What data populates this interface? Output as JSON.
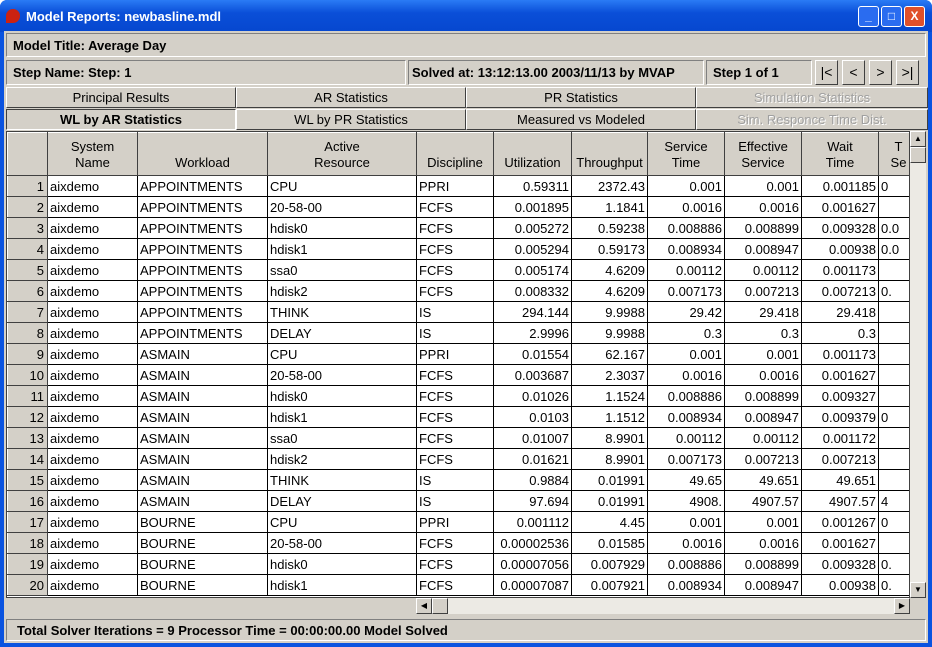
{
  "window": {
    "title": "Model Reports: newbasline.mdl",
    "min": "_",
    "max": "□",
    "close": "X"
  },
  "model_title": "Model Title: Average Day",
  "step_name": "Step Name:  Step: 1",
  "solved_at": "Solved at: 13:12:13.00  2003/11/13 by MVAP",
  "step_of": "Step 1 of 1",
  "nav": {
    "first": "|<",
    "prev": "<",
    "next": ">",
    "last": ">|"
  },
  "tabs_row1": [
    {
      "label": "Principal Results",
      "enabled": true
    },
    {
      "label": "AR Statistics",
      "enabled": true
    },
    {
      "label": "PR Statistics",
      "enabled": true
    },
    {
      "label": "Simulation Statistics",
      "enabled": false
    }
  ],
  "tabs_row2": [
    {
      "label": "WL by AR Statistics",
      "enabled": true,
      "active": true
    },
    {
      "label": "WL by PR Statistics",
      "enabled": true
    },
    {
      "label": "Measured vs Modeled",
      "enabled": true
    },
    {
      "label": "Sim. Responce Time Dist.",
      "enabled": false
    }
  ],
  "columns": [
    [
      "",
      ""
    ],
    [
      "System",
      "Name"
    ],
    [
      "",
      "Workload"
    ],
    [
      "Active",
      "Resource"
    ],
    [
      "",
      "Discipline"
    ],
    [
      "",
      "Utilization"
    ],
    [
      "",
      "Throughput"
    ],
    [
      "Service",
      "Time"
    ],
    [
      "Effective",
      "Service"
    ],
    [
      "Wait",
      "Time"
    ],
    [
      "T",
      "Se"
    ]
  ],
  "rows": [
    [
      "1",
      "aixdemo",
      "APPOINTMENTS",
      "CPU",
      "PPRI",
      "0.59311",
      "2372.43",
      "0.001",
      "0.001",
      "0.001185",
      "0"
    ],
    [
      "2",
      "aixdemo",
      "APPOINTMENTS",
      "20-58-00",
      "FCFS",
      "0.001895",
      "1.1841",
      "0.0016",
      "0.0016",
      "0.001627",
      ""
    ],
    [
      "3",
      "aixdemo",
      "APPOINTMENTS",
      "hdisk0",
      "FCFS",
      "0.005272",
      "0.59238",
      "0.008886",
      "0.008899",
      "0.009328",
      "0.0"
    ],
    [
      "4",
      "aixdemo",
      "APPOINTMENTS",
      "hdisk1",
      "FCFS",
      "0.005294",
      "0.59173",
      "0.008934",
      "0.008947",
      "0.00938",
      "0.0"
    ],
    [
      "5",
      "aixdemo",
      "APPOINTMENTS",
      "ssa0",
      "FCFS",
      "0.005174",
      "4.6209",
      "0.00112",
      "0.00112",
      "0.001173",
      ""
    ],
    [
      "6",
      "aixdemo",
      "APPOINTMENTS",
      "hdisk2",
      "FCFS",
      "0.008332",
      "4.6209",
      "0.007173",
      "0.007213",
      "0.007213",
      "0."
    ],
    [
      "7",
      "aixdemo",
      "APPOINTMENTS",
      "THINK",
      "IS",
      "294.144",
      "9.9988",
      "29.42",
      "29.418",
      "29.418",
      ""
    ],
    [
      "8",
      "aixdemo",
      "APPOINTMENTS",
      "DELAY",
      "IS",
      "2.9996",
      "9.9988",
      "0.3",
      "0.3",
      "0.3",
      ""
    ],
    [
      "9",
      "aixdemo",
      "ASMAIN",
      "CPU",
      "PPRI",
      "0.01554",
      "62.167",
      "0.001",
      "0.001",
      "0.001173",
      ""
    ],
    [
      "10",
      "aixdemo",
      "ASMAIN",
      "20-58-00",
      "FCFS",
      "0.003687",
      "2.3037",
      "0.0016",
      "0.0016",
      "0.001627",
      ""
    ],
    [
      "11",
      "aixdemo",
      "ASMAIN",
      "hdisk0",
      "FCFS",
      "0.01026",
      "1.1524",
      "0.008886",
      "0.008899",
      "0.009327",
      ""
    ],
    [
      "12",
      "aixdemo",
      "ASMAIN",
      "hdisk1",
      "FCFS",
      "0.0103",
      "1.1512",
      "0.008934",
      "0.008947",
      "0.009379",
      "0"
    ],
    [
      "13",
      "aixdemo",
      "ASMAIN",
      "ssa0",
      "FCFS",
      "0.01007",
      "8.9901",
      "0.00112",
      "0.00112",
      "0.001172",
      ""
    ],
    [
      "14",
      "aixdemo",
      "ASMAIN",
      "hdisk2",
      "FCFS",
      "0.01621",
      "8.9901",
      "0.007173",
      "0.007213",
      "0.007213",
      ""
    ],
    [
      "15",
      "aixdemo",
      "ASMAIN",
      "THINK",
      "IS",
      "0.9884",
      "0.01991",
      "49.65",
      "49.651",
      "49.651",
      ""
    ],
    [
      "16",
      "aixdemo",
      "ASMAIN",
      "DELAY",
      "IS",
      "97.694",
      "0.01991",
      "4908.",
      "4907.57",
      "4907.57",
      "4"
    ],
    [
      "17",
      "aixdemo",
      "BOURNE",
      "CPU",
      "PPRI",
      "0.001112",
      "4.45",
      "0.001",
      "0.001",
      "0.001267",
      "0"
    ],
    [
      "18",
      "aixdemo",
      "BOURNE",
      "20-58-00",
      "FCFS",
      "0.00002536",
      "0.01585",
      "0.0016",
      "0.0016",
      "0.001627",
      ""
    ],
    [
      "19",
      "aixdemo",
      "BOURNE",
      "hdisk0",
      "FCFS",
      "0.00007056",
      "0.007929",
      "0.008886",
      "0.008899",
      "0.009328",
      "0."
    ],
    [
      "20",
      "aixdemo",
      "BOURNE",
      "hdisk1",
      "FCFS",
      "0.00007087",
      "0.007921",
      "0.008934",
      "0.008947",
      "0.00938",
      "0."
    ]
  ],
  "status": "Total Solver Iterations =  9  Processor Time = 00:00:00.00  Model Solved"
}
